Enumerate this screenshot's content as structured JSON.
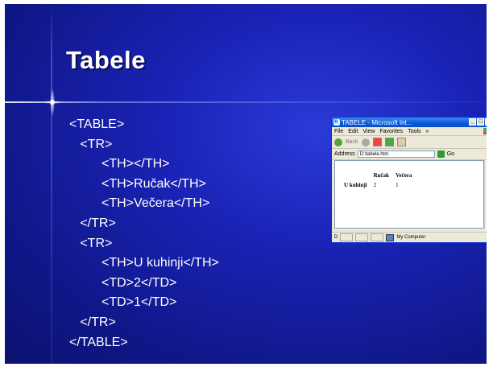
{
  "slide": {
    "title": "Tabele",
    "code_lines": [
      "<TABLE>",
      "   <TR>",
      "         <TH></TH>",
      "         <TH>Ručak</TH>",
      "         <TH>Večera</TH>",
      "   </TR>",
      "   <TR>",
      "         <TH>U kuhinji</TH>",
      "         <TD>2</TD>",
      "         <TD>1</TD>",
      "   </TR>",
      "</TABLE>"
    ]
  },
  "browser": {
    "title": "TABELE - Microsoft Int...",
    "menu": [
      "File",
      "Edit",
      "View",
      "Favorites",
      "Tools",
      "»"
    ],
    "back_label": "Back",
    "address_label": "Address",
    "address_value": "D:\\tabele.htm",
    "go_label": "Go",
    "table": {
      "headers": [
        "",
        "Ručak",
        "Večera"
      ],
      "row_header": "U kuhinji",
      "cells": [
        "2",
        "1"
      ]
    },
    "status_left": "D",
    "status_zone": "My Computer"
  }
}
